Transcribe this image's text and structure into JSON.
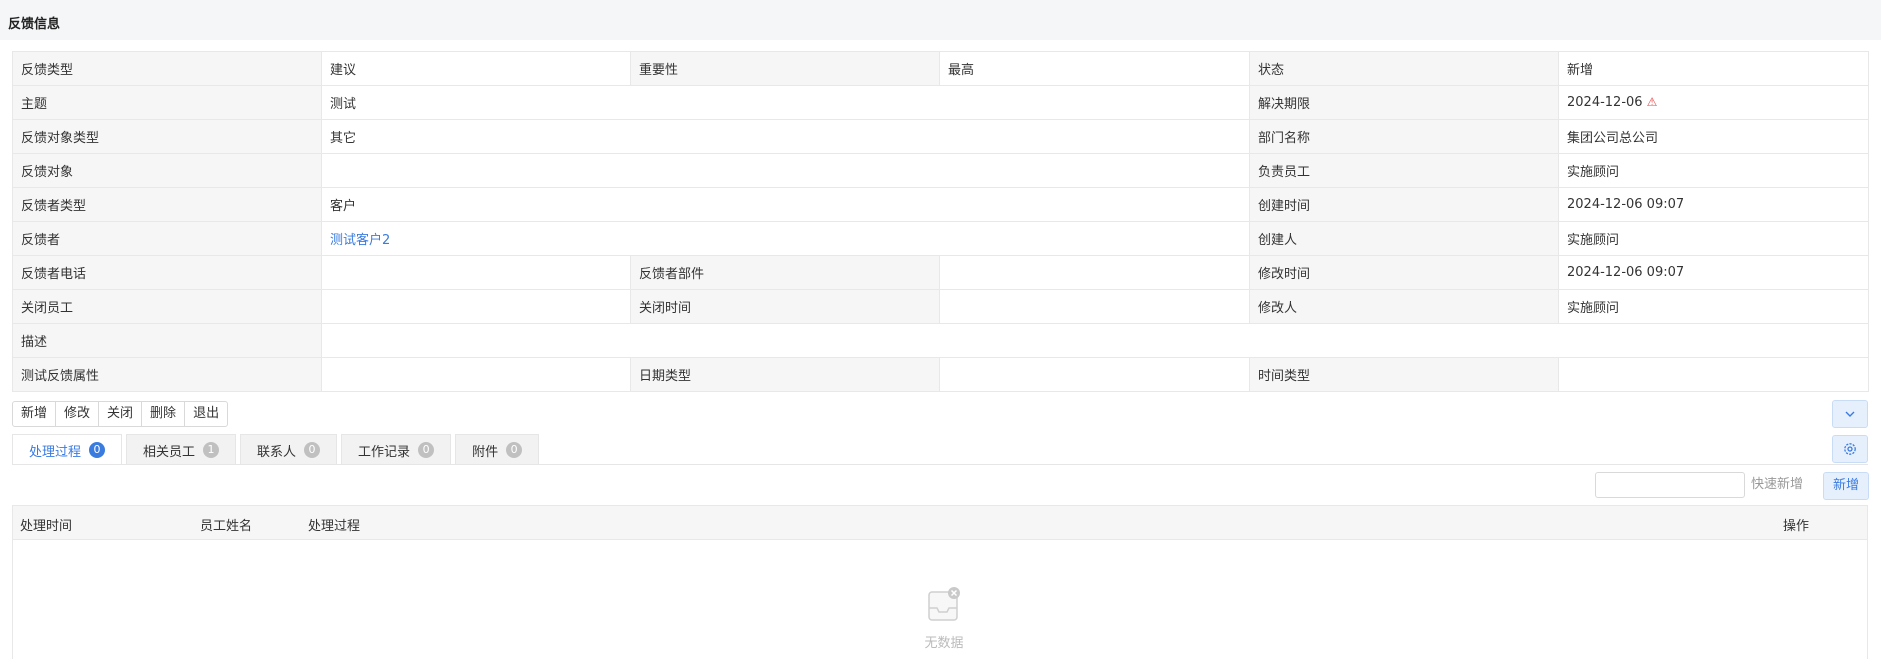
{
  "section_title": "反馈信息",
  "info": {
    "r1": {
      "l1": "反馈类型",
      "v1": "建议",
      "l2": "重要性",
      "v2": "最高",
      "l3": "状态",
      "v3": "新增"
    },
    "r2": {
      "l1": "主题",
      "v1": "测试",
      "l3": "解决期限",
      "v3": "2024-12-06",
      "warn_icon": "⚠"
    },
    "r3": {
      "l1": "反馈对象类型",
      "v1": "其它",
      "l3": "部门名称",
      "v3": "集团公司总公司"
    },
    "r4": {
      "l1": "反馈对象",
      "v1": "",
      "l3": "负责员工",
      "v3": "实施顾问"
    },
    "r5": {
      "l1": "反馈者类型",
      "v1": "客户",
      "l3": "创建时间",
      "v3": "2024-12-06 09:07"
    },
    "r6": {
      "l1": "反馈者",
      "v1": "测试客户2",
      "l3": "创建人",
      "v3": "实施顾问"
    },
    "r7": {
      "l1": "反馈者电话",
      "v1": "",
      "l2": "反馈者部件",
      "v2": "",
      "l3": "修改时间",
      "v3": "2024-12-06 09:07"
    },
    "r8": {
      "l1": "关闭员工",
      "v1": "",
      "l2": "关闭时间",
      "v2": "",
      "l3": "修改人",
      "v3": "实施顾问"
    },
    "r9": {
      "l1": "描述",
      "v1": ""
    },
    "r10": {
      "l1": "测试反馈属性",
      "v1": "",
      "l2": "日期类型",
      "v2": "",
      "l3": "时间类型",
      "v3": ""
    }
  },
  "actions": [
    "新增",
    "修改",
    "关闭",
    "删除",
    "退出"
  ],
  "tabs": [
    {
      "label": "处理过程",
      "count": "0"
    },
    {
      "label": "相关员工",
      "count": "1"
    },
    {
      "label": "联系人",
      "count": "0"
    },
    {
      "label": "工作记录",
      "count": "0"
    },
    {
      "label": "附件",
      "count": "0"
    }
  ],
  "quick_add_label": "快速新增",
  "new_label": "新增",
  "grid": {
    "columns": [
      "处理时间",
      "员工姓名",
      "处理过程",
      "操作"
    ],
    "empty_text": "无数据"
  },
  "colors": {
    "accent": "#3a7be0",
    "warn": "#e34848"
  }
}
